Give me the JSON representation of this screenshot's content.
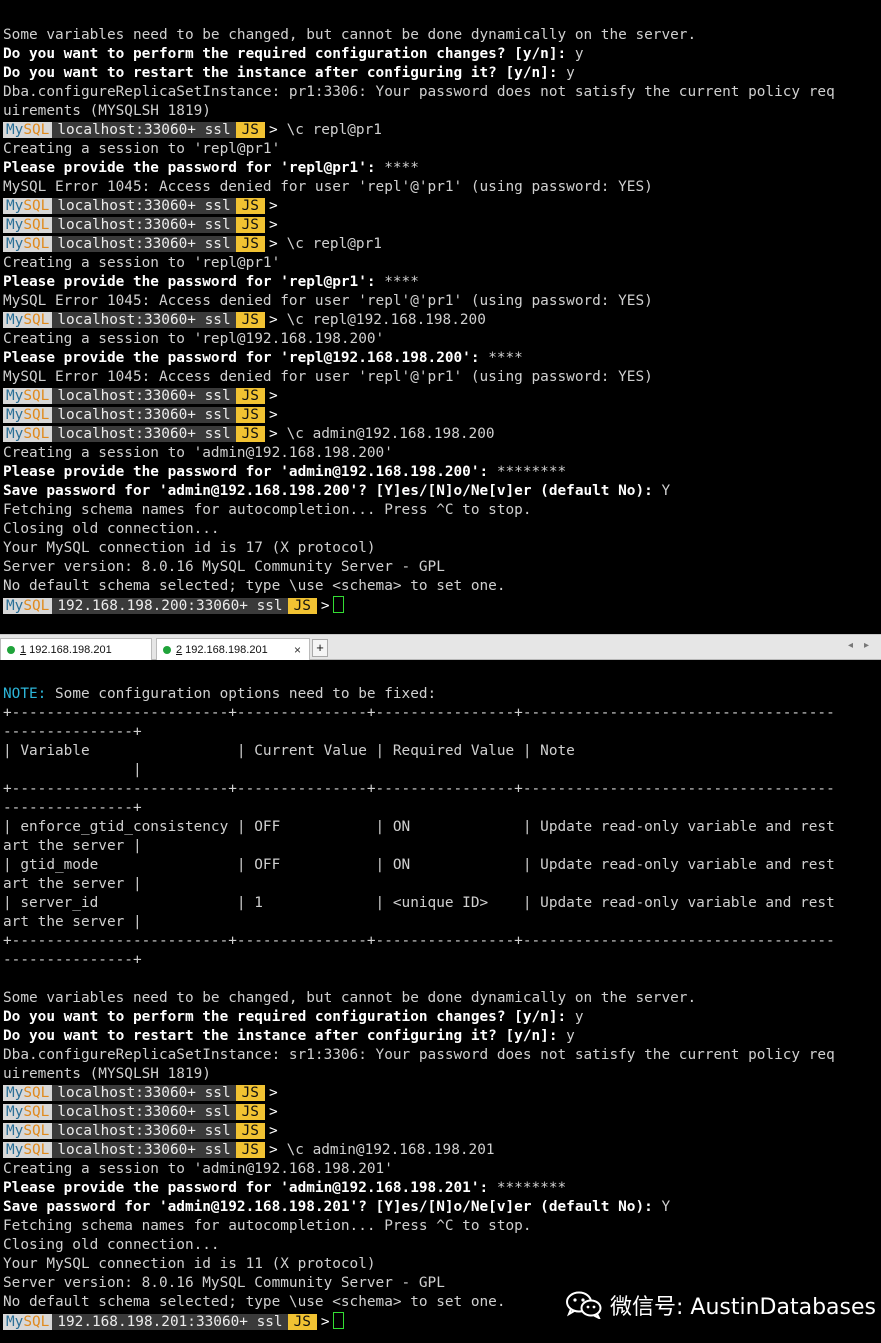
{
  "prompt": {
    "mysql_my": "My",
    "mysql_sql": "SQL",
    "lang": "JS",
    "arrow": ">"
  },
  "terminal1": {
    "lines": [
      {
        "t": "Some variables need to be changed, but cannot be done dynamically on the server."
      },
      {
        "t": "Do you want to perform the required configuration changes? [y/n]: ",
        "b": true,
        "u": "y"
      },
      {
        "t": "Do you want to restart the instance after configuring it? [y/n]: ",
        "b": true,
        "u": "y"
      },
      {
        "t": "Dba.configureReplicaSetInstance: pr1:3306: Your password does not satisfy the current policy req"
      },
      {
        "t": "uirements (MYSQLSH 1819)"
      },
      {
        "p": "localhost:33060+ ssl",
        "c": "\\c repl@pr1"
      },
      {
        "t": "Creating a session to 'repl@pr1'"
      },
      {
        "t": "Please provide the password for 'repl@pr1': ",
        "b": true,
        "u": "****"
      },
      {
        "t": "MySQL Error 1045: Access denied for user 'repl'@'pr1' (using password: YES)"
      },
      {
        "p": "localhost:33060+ ssl",
        "c": ""
      },
      {
        "p": "localhost:33060+ ssl",
        "c": ""
      },
      {
        "p": "localhost:33060+ ssl",
        "c": "\\c repl@pr1"
      },
      {
        "t": "Creating a session to 'repl@pr1'"
      },
      {
        "t": "Please provide the password for 'repl@pr1': ",
        "b": true,
        "u": "****"
      },
      {
        "t": "MySQL Error 1045: Access denied for user 'repl'@'pr1' (using password: YES)"
      },
      {
        "p": "localhost:33060+ ssl",
        "c": "\\c repl@192.168.198.200"
      },
      {
        "t": "Creating a session to 'repl@192.168.198.200'"
      },
      {
        "t": "Please provide the password for 'repl@192.168.198.200': ",
        "b": true,
        "u": "****"
      },
      {
        "t": "MySQL Error 1045: Access denied for user 'repl'@'pr1' (using password: YES)"
      },
      {
        "p": "localhost:33060+ ssl",
        "c": ""
      },
      {
        "p": "localhost:33060+ ssl",
        "c": ""
      },
      {
        "p": "localhost:33060+ ssl",
        "c": "\\c admin@192.168.198.200"
      },
      {
        "t": "Creating a session to 'admin@192.168.198.200'"
      },
      {
        "t": "Please provide the password for 'admin@192.168.198.200': ",
        "b": true,
        "u": "********"
      },
      {
        "t": "Save password for 'admin@192.168.198.200'? [Y]es/[N]o/Ne[v]er (default No): ",
        "b": true,
        "u": "Y"
      },
      {
        "t": "Fetching schema names for autocompletion... Press ^C to stop."
      },
      {
        "t": "Closing old connection..."
      },
      {
        "t": "Your MySQL connection id is 17 (X protocol)"
      },
      {
        "t": "Server version: 8.0.16 MySQL Community Server - GPL"
      },
      {
        "t": "No default schema selected; type \\use <schema> to set one."
      },
      {
        "p": "192.168.198.200:33060+ ssl",
        "c": "",
        "cur": true
      }
    ]
  },
  "tabs": [
    {
      "num": "1",
      "label": "192.168.198.201",
      "close": "×"
    },
    {
      "num": "2",
      "label": "192.168.198.201",
      "close": "×"
    }
  ],
  "tab_add": "+",
  "tab_nav": {
    "left": "◂",
    "right": "▸"
  },
  "terminal2": {
    "lines": [
      {
        "t": " Some configuration options need to be fixed:",
        "nk": "NOTE:"
      },
      {
        "t": "+-------------------------+---------------+----------------+------------------------------------"
      },
      {
        "t": "---------------+"
      },
      {
        "t": "| Variable                 | Current Value | Required Value | Note"
      },
      {
        "t": "               |"
      },
      {
        "t": "+-------------------------+---------------+----------------+------------------------------------"
      },
      {
        "t": "---------------+"
      },
      {
        "t": "| enforce_gtid_consistency | OFF           | ON             | Update read-only variable and rest"
      },
      {
        "t": "art the server |"
      },
      {
        "t": "| gtid_mode                | OFF           | ON             | Update read-only variable and rest"
      },
      {
        "t": "art the server |"
      },
      {
        "t": "| server_id                | 1             | <unique ID>    | Update read-only variable and rest"
      },
      {
        "t": "art the server |"
      },
      {
        "t": "+-------------------------+---------------+----------------+------------------------------------"
      },
      {
        "t": "---------------+"
      },
      {
        "t": ""
      },
      {
        "t": "Some variables need to be changed, but cannot be done dynamically on the server."
      },
      {
        "t": "Do you want to perform the required configuration changes? [y/n]: ",
        "b": true,
        "u": "y"
      },
      {
        "t": "Do you want to restart the instance after configuring it? [y/n]: ",
        "b": true,
        "u": "y"
      },
      {
        "t": "Dba.configureReplicaSetInstance: sr1:3306: Your password does not satisfy the current policy req"
      },
      {
        "t": "uirements (MYSQLSH 1819)"
      },
      {
        "p": "localhost:33060+ ssl",
        "c": ""
      },
      {
        "p": "localhost:33060+ ssl",
        "c": ""
      },
      {
        "p": "localhost:33060+ ssl",
        "c": ""
      },
      {
        "p": "localhost:33060+ ssl",
        "c": "\\c admin@192.168.198.201"
      },
      {
        "t": "Creating a session to 'admin@192.168.198.201'"
      },
      {
        "t": "Please provide the password for 'admin@192.168.198.201': ",
        "b": true,
        "u": "********"
      },
      {
        "t": "Save password for 'admin@192.168.198.201'? [Y]es/[N]o/Ne[v]er (default No): ",
        "b": true,
        "u": "Y"
      },
      {
        "t": "Fetching schema names for autocompletion... Press ^C to stop."
      },
      {
        "t": "Closing old connection..."
      },
      {
        "t": "Your MySQL connection id is 11 (X protocol)"
      },
      {
        "t": "Server version: 8.0.16 MySQL Community Server - GPL"
      },
      {
        "t": "No default schema selected; type \\use <schema> to set one."
      },
      {
        "p": "192.168.198.201:33060+ ssl",
        "c": "",
        "cur": true
      }
    ]
  },
  "watermark": {
    "text": "微信号: AustinDatabases",
    "icon": "wechat-icon"
  },
  "colors": {
    "background": "#000000",
    "text": "#d0d0d0",
    "prompt_js": "#f1c232",
    "cursor": "#33dd33",
    "note": "#2cb5d8"
  }
}
